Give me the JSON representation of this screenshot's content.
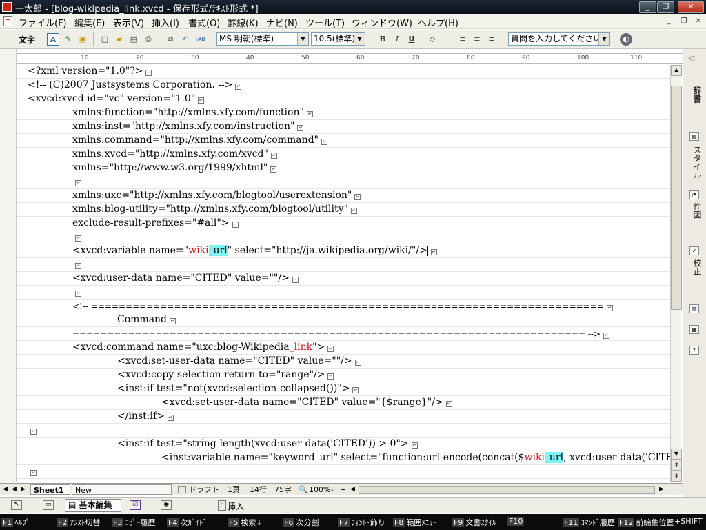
{
  "window": {
    "title": "一太郎 - [blog-wikipedia_link.xvcd - 保存形式/ﾃｷｽﾄ形式 *]",
    "minimize": "_",
    "restore": "❐",
    "close": "✕"
  },
  "menu": [
    "ファイル(F)",
    "編集(E)",
    "表示(V)",
    "挿入(I)",
    "書式(O)",
    "罫線(K)",
    "ナビ(N)",
    "ツール(T)",
    "ウィンドウ(W)",
    "ヘルプ(H)"
  ],
  "toolbar": {
    "mode_label": "文字",
    "font_name": "MS 明朝(標準)",
    "font_size": "10.5(標準)",
    "bold": "B",
    "italic": "I",
    "underline": "U",
    "question_placeholder": "質問を入力してください"
  },
  "ruler": [
    "10",
    "20",
    "30",
    "40",
    "50",
    "60",
    "70",
    "80",
    "90",
    "100",
    "110"
  ],
  "document": {
    "lines": [
      "<?xml version=\"1.0\"?>",
      "<!-- (C)2007 Justsystems Corporation. -->",
      "<xvcd:xvcd id=\"vc\" version=\"1.0\"",
      "xmlns:function=\"http://xmlns.xfy.com/function\"",
      "xmlns:inst=\"http://xmlns.xfy.com/instruction\"",
      "xmlns:command=\"http://xmlns.xfy.com/command\"",
      "xmlns:xvcd=\"http://xmlns.xfy.com/xvcd\"",
      "xmlns=\"http://www.w3.org/1999/xhtml\"",
      "",
      "xmlns:uxc=\"http://xmlns.xfy.com/blogtool/userextension\"",
      "xmlns:blog-utility=\"http://xmlns.xfy.com/blogtool/utility\"",
      "exclude-result-prefixes=\"#all\">",
      "",
      "",
      "",
      "<xvcd:user-data name=\"CITED\" value=\"\"/>",
      "",
      "<!-- ==========================================================================",
      "Command",
      "========================================================================== -->",
      "",
      "<xvcd:set-user-data name=\"CITED\" value=\"\"/>",
      "<xvcd:copy-selection return-to=\"range\"/>",
      "<inst:if test=\"not(xvcd:selection-collapsed())\">",
      "<xvcd:set-user-data name=\"CITED\" value=\"{$range}\"/>",
      "</inst:if>",
      "",
      "<inst:if test=\"string-length(xvcd:user-data('CITED')) > 0\">",
      "",
      ""
    ],
    "variable_line": {
      "before": "<xvcd:variable name=\"",
      "red": "wiki",
      "hl": "_url",
      "after": "\" select=\"http://ja.wikipedia.org/wiki/\"/>"
    },
    "command_line": {
      "before": "<xvcd:command name=\"uxc:blog-Wikipedia",
      "red": "_link",
      "after": "\">"
    },
    "keyword_line": {
      "before": "<inst:variable name=\"keyword_url\" select=\"function:url-encode(concat($",
      "red": "wiki",
      "hl": "_url",
      "after": ", xvcd:user-data('CITED')))\"/"
    }
  },
  "side_panel": [
    "辞書",
    "スタイル",
    "作図",
    "校正"
  ],
  "sheet": {
    "tab": "Sheet1",
    "new": "New",
    "view": "ドラフト",
    "page": "1頁",
    "line": "14行",
    "chars": "75字",
    "zoom": "100%"
  },
  "modes": {
    "basic_edit": "基本編集",
    "insert_key": "F",
    "insert": "挿入"
  },
  "fkeys": [
    {
      "key": "F1",
      "label": "ﾍﾙﾌﾟ"
    },
    {
      "key": "F2",
      "label": "ｱｼｽﾄ切替"
    },
    {
      "key": "F3",
      "label": "ｺﾋﾟｰ履歴"
    },
    {
      "key": "F4",
      "label": "次ｶﾞｲﾄﾞ"
    },
    {
      "key": "F5",
      "label": "検索↓"
    },
    {
      "key": "F6",
      "label": "次分割"
    },
    {
      "key": "F7",
      "label": "ﾌｫﾝﾄ･飾り"
    },
    {
      "key": "F8",
      "label": "範囲ﾒﾆｭｰ"
    },
    {
      "key": "F9",
      "label": "文書ｽﾀｲﾙ"
    },
    {
      "key": "F10",
      "label": ""
    },
    {
      "key": "F11",
      "label": "ｺﾏﾝﾄﾞ履歴"
    },
    {
      "key": "F12",
      "label": "前編集位置"
    },
    {
      "key": "",
      "label": "+SHIFT"
    }
  ]
}
